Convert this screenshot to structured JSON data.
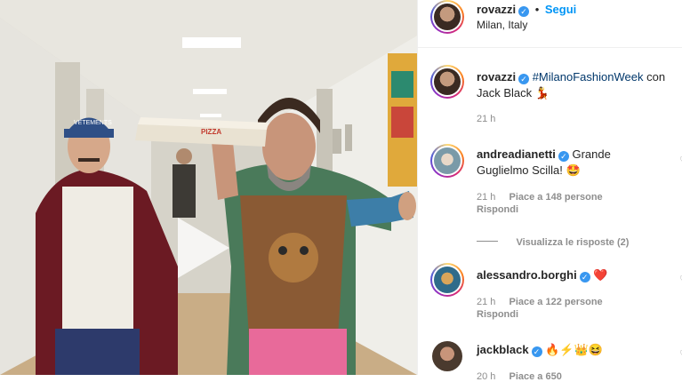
{
  "post": {
    "author": {
      "username": "rovazzi",
      "location": "Milan, Italy",
      "follow_label": "Segui",
      "separator": "•"
    },
    "video": {
      "pizza_box_text": "PIZZA",
      "cap_text": "VETEMENTS",
      "play_icon": "play-icon"
    }
  },
  "comments": [
    {
      "username": "rovazzi",
      "hashtag": "#MilanoFashionWeek",
      "text_after": " con",
      "text_line2": "Jack Black",
      "emoji": "💃",
      "time": "21 h"
    },
    {
      "username": "andreadianetti",
      "text": "Grande",
      "text_line2": "Guglielmo Scilla!",
      "emoji": "🤩",
      "time": "21 h",
      "likes": "Piace a 148 persone",
      "reply": "Rispondi"
    },
    {
      "view_replies": "Visualizza le risposte (2)"
    },
    {
      "username": "alessandro.borghi",
      "emoji": "❤️",
      "time": "21 h",
      "likes": "Piace a 122 persone",
      "reply": "Rispondi"
    },
    {
      "username": "jackblack",
      "emoji": "🔥⚡👑😆",
      "time": "20 h",
      "likes": "Piace a 650"
    }
  ],
  "colors": {
    "verified": "#3897f0",
    "link": "#0095f6",
    "muted": "#8e8e8e"
  }
}
